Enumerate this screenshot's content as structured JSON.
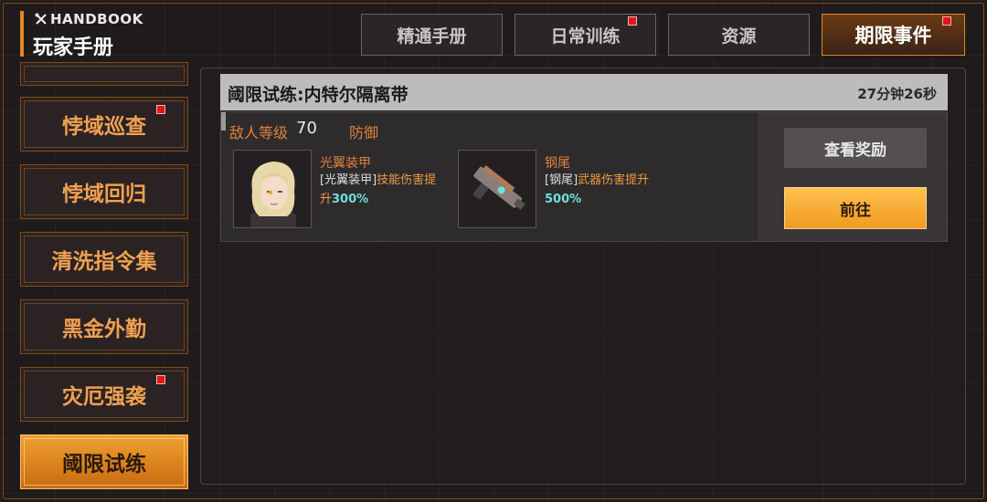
{
  "header": {
    "subtitle": "HANDBOOK",
    "title": "玩家手册",
    "tabs": [
      {
        "label": "精通手册",
        "active": false,
        "badge": false
      },
      {
        "label": "日常训练",
        "active": false,
        "badge": true
      },
      {
        "label": "资源",
        "active": false,
        "badge": false
      },
      {
        "label": "期限事件",
        "active": true,
        "badge": true
      }
    ]
  },
  "sidebar": {
    "items": [
      {
        "label": "",
        "active": false,
        "badge": false
      },
      {
        "label": "悖域巡查",
        "active": false,
        "badge": true
      },
      {
        "label": "悖域回归",
        "active": false,
        "badge": false
      },
      {
        "label": "清洗指令集",
        "active": false,
        "badge": false
      },
      {
        "label": "黑金外勤",
        "active": false,
        "badge": false
      },
      {
        "label": "灾厄强袭",
        "active": false,
        "badge": true
      },
      {
        "label": "阈限试练",
        "active": true,
        "badge": false
      }
    ]
  },
  "event": {
    "title": "阈限试练:内特尔隔离带",
    "timer": "27分钟26秒",
    "enemy_level_label": "敌人等级",
    "enemy_level": "70",
    "type": "防御",
    "rewards": [
      {
        "name": "光翼装甲",
        "desc_tag": "[光翼装甲]",
        "desc_effect": "技能伤害提升",
        "desc_value": "300%"
      },
      {
        "name": "钢尾",
        "desc_tag": "[钢尾]",
        "desc_effect": "武器伤害提升",
        "desc_value": "500%"
      }
    ],
    "view_rewards_label": "查看奖励",
    "go_label": "前往"
  },
  "colors": {
    "accent": "#e08a1e",
    "badge": "#e01818",
    "highlight_text": "#e0803a",
    "percent_text": "#6ee0d8"
  }
}
